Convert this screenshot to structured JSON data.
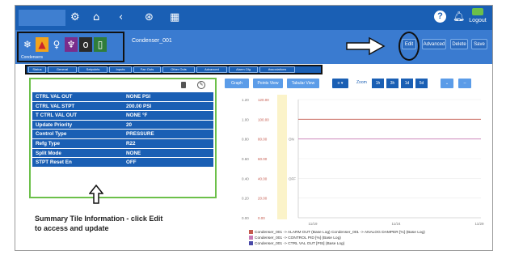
{
  "topbar": {
    "icons": [
      "gear-icon",
      "home-icon",
      "back-icon",
      "network-icon",
      "calendar-icon",
      "help-icon",
      "bell-icon"
    ],
    "help_glyph": "?",
    "logout_label": "Logout"
  },
  "toolbar": {
    "strip_icons": [
      "snowflake-icon",
      "fire-icon",
      "bulb-icon",
      "plug-icon",
      "sensor-icon",
      "door-icon"
    ],
    "strip_caption": "Condensers",
    "device_name": "Condenser_001",
    "edit_label": "Edit",
    "advanced_label": "Advanced",
    "delete_label": "Delete",
    "save_label": "Save"
  },
  "tabs": [
    "Status",
    "General",
    "Setpoints",
    "Inputs",
    "Fan Outs",
    "Other Outs",
    "Advanced",
    "Alarm Cfg",
    "Associations"
  ],
  "summary": {
    "rows": [
      {
        "label": "CTRL VAL OUT",
        "value": "NONE PSI"
      },
      {
        "label": "CTRL VAL STPT",
        "value": "200.00 PSI"
      },
      {
        "label": "T CTRL VAL OUT",
        "value": "NONE °F"
      },
      {
        "label": "Update Priority",
        "value": "20"
      },
      {
        "label": "Control Type",
        "value": "PRESSURE"
      },
      {
        "label": "Refg Type",
        "value": "R22"
      },
      {
        "label": "Split Mode",
        "value": "NONE"
      },
      {
        "label": "STPT Reset En",
        "value": "OFF"
      }
    ]
  },
  "annotation": {
    "line1": "Summary Tile Information - click Edit",
    "line2": "to access and update"
  },
  "chart_controls": {
    "graph_label": "Graph",
    "point_view_label": "Points View",
    "tabular_view_label": "Tabular View",
    "menu_glyph": "≡ ▾",
    "zoom_label": "Zoom",
    "zoom_options": [
      "1h",
      "3h",
      "1d",
      "5d"
    ],
    "down_glyph": "⌄",
    "minus_glyph": "–"
  },
  "chart_data": {
    "type": "line",
    "x_ticks": [
      "11/19",
      "11/24",
      "11/29"
    ],
    "y1_ticks": [
      "0.00",
      "0.20",
      "0.40",
      "0.60",
      "0.80",
      "1.00",
      "1.20"
    ],
    "y2_ticks": [
      "0.00",
      "20.00",
      "40.00",
      "60.00",
      "80.00",
      "100.00",
      "120.00"
    ],
    "y3_ticks": [
      "",
      "",
      "OFF",
      "",
      "ON",
      "",
      ""
    ],
    "ylim": [
      0,
      1.2
    ],
    "series": [
      {
        "name": "Condenser_001 -> ALARM OUT (Base Log)",
        "color": "#c55a4e",
        "values": [
          1.0,
          1.0
        ]
      },
      {
        "name": "Condenser_001 -> ANALOG DAMPER [%] (Base Log)",
        "color": "#e8c53a",
        "values": [
          null,
          null
        ]
      },
      {
        "name": "Condenser_001 -> CONTROL PID [%] (Base Log)",
        "color": "#c77ab5",
        "values": [
          0.8,
          0.8
        ]
      },
      {
        "name": "Condenser_001 -> CTRL VAL OUT [PSI] (Base Log)",
        "color": "#4a4aa8",
        "values": [
          null,
          null
        ]
      }
    ],
    "legend_lines": [
      "Condenser_001 -> ALARM OUT (Base Log)  Condenser_001 -> ANALOG DAMPER [%] (Base Log)",
      "Condenser_001 -> CONTROL PID [%] (Base Log)",
      "Condenser_001 -> CTRL VAL OUT [PSI] (Base Log)"
    ],
    "grid": true
  }
}
